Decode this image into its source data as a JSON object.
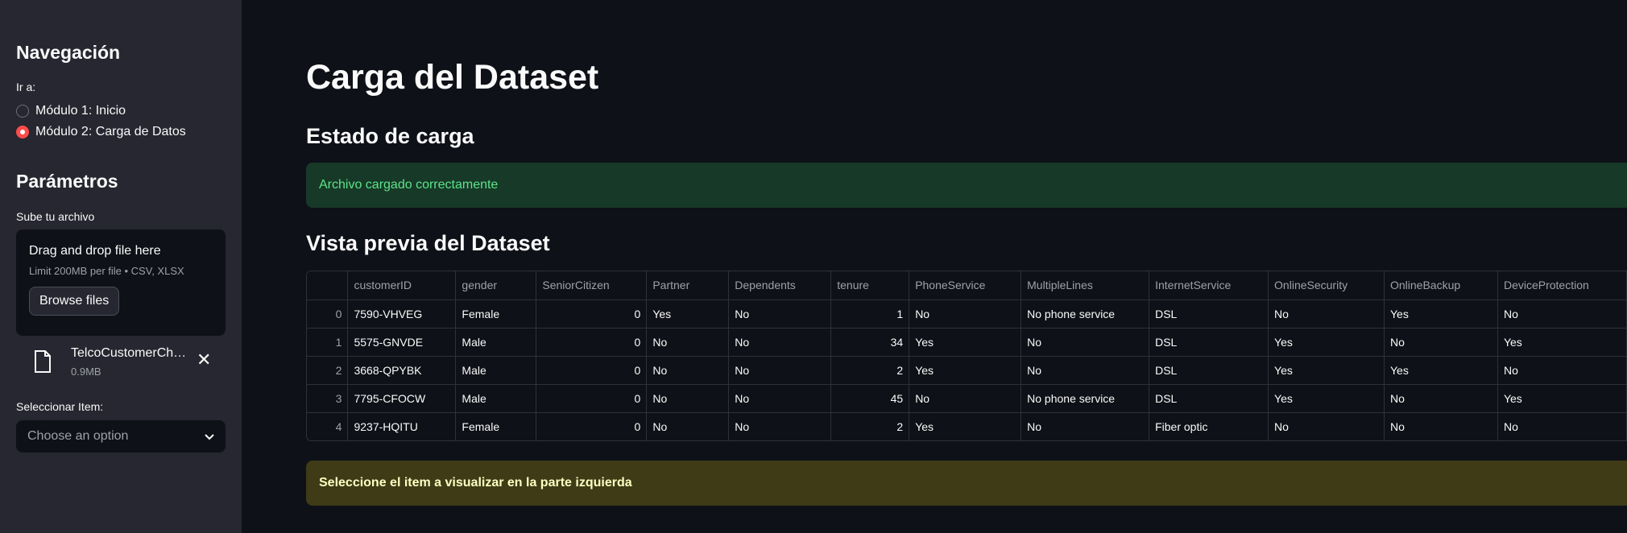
{
  "sidebar": {
    "nav_title": "Navegación",
    "goto_label": "Ir a:",
    "radio_options": [
      "Módulo 1: Inicio",
      "Módulo 2: Carga de Datos"
    ],
    "selected_index": 1,
    "params_title": "Parámetros",
    "upload_label": "Sube tu archivo",
    "uploader": {
      "title": "Drag and drop file here",
      "limit": "Limit 200MB per file • CSV, XLSX",
      "browse_label": "Browse files"
    },
    "file": {
      "name": "TelcoCustomerChurn.csv",
      "size": "0.9MB"
    },
    "select_label": "Seleccionar Item:",
    "select_placeholder": "Choose an option"
  },
  "main": {
    "title": "Carga del Dataset",
    "status_heading": "Estado de carga",
    "success_message": "Archivo cargado correctamente",
    "preview_heading": "Vista previa del Dataset",
    "warning_message": "Seleccione el item a visualizar en la parte izquierda"
  },
  "table": {
    "columns": [
      "",
      "customerID",
      "gender",
      "SeniorCitizen",
      "Partner",
      "Dependents",
      "tenure",
      "PhoneService",
      "MultipleLines",
      "InternetService",
      "OnlineSecurity",
      "OnlineBackup",
      "DeviceProtection"
    ],
    "rows": [
      [
        "0",
        "7590-VHVEG",
        "Female",
        "0",
        "Yes",
        "No",
        "1",
        "No",
        "No phone service",
        "DSL",
        "No",
        "Yes",
        "No"
      ],
      [
        "1",
        "5575-GNVDE",
        "Male",
        "0",
        "No",
        "No",
        "34",
        "Yes",
        "No",
        "DSL",
        "Yes",
        "No",
        "Yes"
      ],
      [
        "2",
        "3668-QPYBK",
        "Male",
        "0",
        "No",
        "No",
        "2",
        "Yes",
        "No",
        "DSL",
        "Yes",
        "Yes",
        "No"
      ],
      [
        "3",
        "7795-CFOCW",
        "Male",
        "0",
        "No",
        "No",
        "45",
        "No",
        "No phone service",
        "DSL",
        "Yes",
        "No",
        "Yes"
      ],
      [
        "4",
        "9237-HQITU",
        "Female",
        "0",
        "No",
        "No",
        "2",
        "Yes",
        "No",
        "Fiber optic",
        "No",
        "No",
        "No"
      ]
    ]
  },
  "colors": {
    "accent": "#ff4b4b",
    "success_bg": "#173928",
    "success_text": "#5ce488",
    "warning_bg": "#3e3b16",
    "warning_text": "#ffffc2"
  }
}
